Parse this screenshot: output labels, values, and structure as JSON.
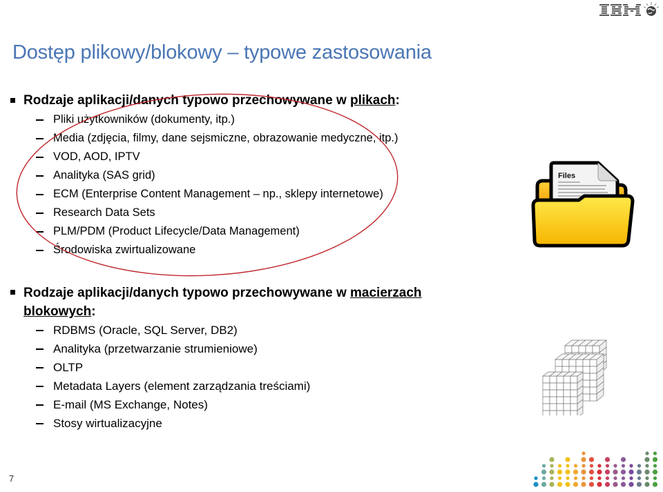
{
  "logo": {
    "name": "IBM",
    "icon": "ibm-globe-icon"
  },
  "title": "Dostęp plikowy/blokowy – typowe zastosowania",
  "sections": [
    {
      "heading_prefix": "Rodzaje aplikacji/danych typowo przechowywane w ",
      "heading_underlined": "plikach",
      "heading_suffix": ":",
      "items": [
        "Pliki użytkowników (dokumenty, itp.)",
        "Media (zdjęcia, filmy, dane sejsmiczne, obrazowanie medyczne, itp.)",
        "VOD, AOD, IPTV",
        "Analityka (SAS grid)",
        "ECM (Enterprise Content Management – np., sklepy internetowe)",
        "Research Data Sets",
        "PLM/PDM (Product Lifecycle/Data Management)",
        "Środowiska zwirtualizowane"
      ],
      "illustration": {
        "icon": "folder-files-icon",
        "label": "Files"
      }
    },
    {
      "heading_prefix": "Rodzaje aplikacji/danych typowo przechowywane w ",
      "heading_underlined_line1": "macierzach",
      "heading_underlined_line2": "blokowych",
      "heading_suffix": ":",
      "items": [
        "RDBMS (Oracle, SQL Server, DB2)",
        "Analityka (przetwarzanie strumieniowe)",
        "OLTP",
        "Metadata Layers (element zarządzania treściami)",
        "E-mail (MS Exchange, Notes)",
        "Stosy wirtualizacyjne"
      ],
      "illustration": {
        "icon": "block-cubes-icon"
      }
    }
  ],
  "annotation": {
    "shape": "red-ellipse",
    "color": "#c0272d"
  },
  "colors": {
    "title": "#4a76b5",
    "annotation": "#c0272d"
  },
  "footer": {
    "page_number": "7",
    "decoration": "colored-dots-icon"
  }
}
